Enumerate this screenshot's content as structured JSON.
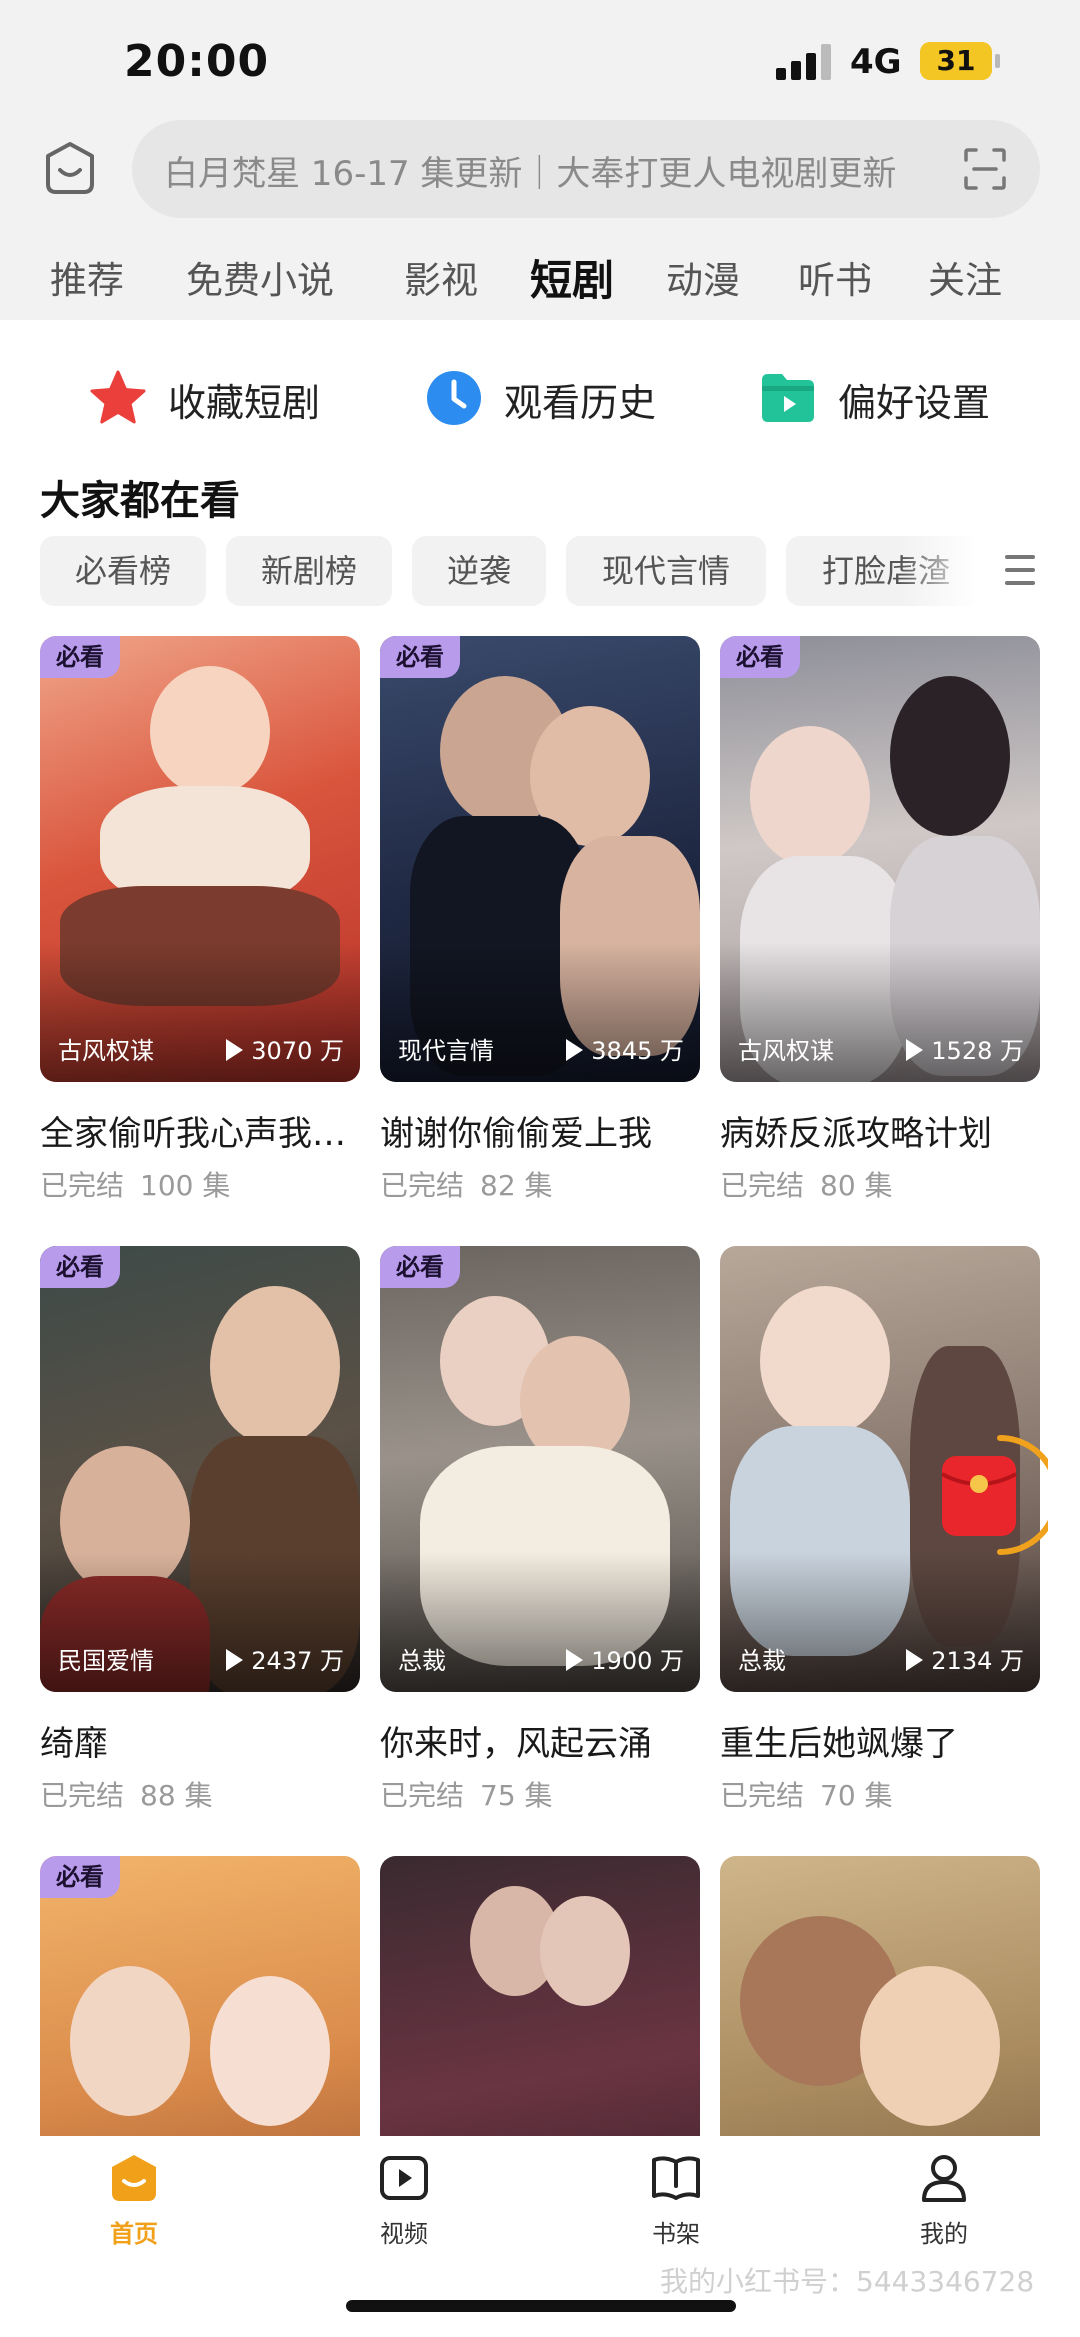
{
  "status_bar": {
    "time": "20:00",
    "network": "4G",
    "battery": "31"
  },
  "search": {
    "placeholder": "白月梵星 16-17 集更新｜大奉打更人电视剧更新"
  },
  "tabs": [
    {
      "label": "推荐",
      "active": false
    },
    {
      "label": "免费小说",
      "active": false
    },
    {
      "label": "影视",
      "active": false
    },
    {
      "label": "短剧",
      "active": true
    },
    {
      "label": "动漫",
      "active": false
    },
    {
      "label": "听书",
      "active": false
    },
    {
      "label": "关注",
      "active": false
    }
  ],
  "quick_actions": [
    {
      "label": "收藏短剧",
      "icon": "star-icon"
    },
    {
      "label": "观看历史",
      "icon": "clock-icon"
    },
    {
      "label": "偏好设置",
      "icon": "folder-icon"
    }
  ],
  "section": {
    "title": "大家都在看"
  },
  "chips": [
    "必看榜",
    "新剧榜",
    "逆袭",
    "现代言情",
    "打脸虐渣"
  ],
  "cards": [
    {
      "badge": "必看",
      "genre": "古风权谋",
      "plays": "3070 万",
      "title": "全家偷听我心声我不是苦命小可怜",
      "status": "已完结",
      "episodes": "100 集"
    },
    {
      "badge": "必看",
      "genre": "现代言情",
      "plays": "3845 万",
      "title": "谢谢你偷偷爱上我",
      "status": "已完结",
      "episodes": "82 集"
    },
    {
      "badge": "必看",
      "genre": "古风权谋",
      "plays": "1528 万",
      "title": "病娇反派攻略计划",
      "status": "已完结",
      "episodes": "80 集"
    },
    {
      "badge": "必看",
      "genre": "民国爱情",
      "plays": "2437 万",
      "title": "绮靡",
      "status": "已完结",
      "episodes": "88 集"
    },
    {
      "badge": "必看",
      "genre": "总裁",
      "plays": "1900 万",
      "title": "你来时，风起云涌",
      "status": "已完结",
      "episodes": "75 集"
    },
    {
      "badge": "",
      "genre": "总裁",
      "plays": "2134 万",
      "title": "重生后她飒爆了",
      "status": "已完结",
      "episodes": "70 集"
    },
    {
      "badge": "必看"
    },
    {
      "badge": ""
    },
    {
      "badge": ""
    }
  ],
  "bottom_nav": [
    {
      "label": "首页",
      "icon": "home-icon",
      "active": true
    },
    {
      "label": "视频",
      "icon": "video-icon",
      "active": false
    },
    {
      "label": "书架",
      "icon": "book-icon",
      "active": false
    },
    {
      "label": "我的",
      "icon": "profile-icon",
      "active": false
    }
  ],
  "watermark": "我的小红书号：5443346728",
  "colors": {
    "accent": "#f1a019",
    "badge": "#b89bea",
    "battery": "#f3c623",
    "star": "#ea3f3a",
    "clock": "#2d8cf0",
    "folder": "#23c39a"
  }
}
